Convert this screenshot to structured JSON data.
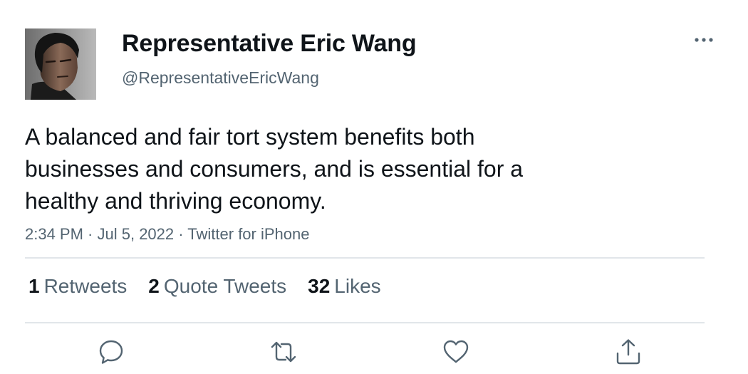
{
  "tweet": {
    "author": {
      "name": "Representative Eric Wang",
      "handle": "@RepresentativeEricWang"
    },
    "text_lines": [
      "A balanced and fair tort system benefits both",
      "businesses and consumers, and is essential for a",
      "healthy and thriving economy."
    ],
    "meta": {
      "time": "2:34 PM",
      "separator": " · ",
      "date": "Jul 5, 2022",
      "source": "Twitter for iPhone"
    },
    "stats": {
      "retweets": {
        "count": "1",
        "label": "Retweets"
      },
      "quote_tweets": {
        "count": "2",
        "label": "Quote Tweets"
      },
      "likes": {
        "count": "32",
        "label": "Likes"
      }
    },
    "icons": {
      "more": "more-horizontal-icon",
      "reply": "reply-icon",
      "retweet": "retweet-icon",
      "like": "heart-icon",
      "share": "share-icon"
    },
    "colors": {
      "primary_text": "#0f1419",
      "secondary_text": "#536471",
      "divider": "#e1e6ea"
    }
  }
}
